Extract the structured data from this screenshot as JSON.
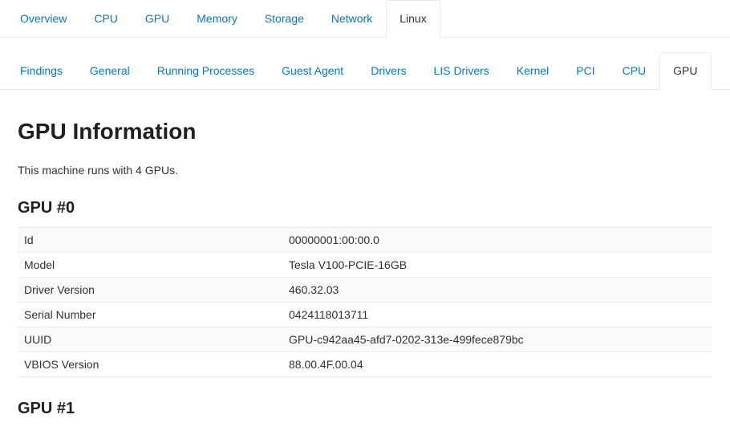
{
  "primaryTabs": [
    {
      "label": "Overview",
      "active": false,
      "name": "tab-overview"
    },
    {
      "label": "CPU",
      "active": false,
      "name": "tab-cpu"
    },
    {
      "label": "GPU",
      "active": false,
      "name": "tab-gpu"
    },
    {
      "label": "Memory",
      "active": false,
      "name": "tab-memory"
    },
    {
      "label": "Storage",
      "active": false,
      "name": "tab-storage"
    },
    {
      "label": "Network",
      "active": false,
      "name": "tab-network"
    },
    {
      "label": "Linux",
      "active": true,
      "name": "tab-linux"
    }
  ],
  "secondaryTabs": [
    {
      "label": "Findings",
      "active": false,
      "name": "subtab-findings"
    },
    {
      "label": "General",
      "active": false,
      "name": "subtab-general"
    },
    {
      "label": "Running Processes",
      "active": false,
      "name": "subtab-running-processes"
    },
    {
      "label": "Guest Agent",
      "active": false,
      "name": "subtab-guest-agent"
    },
    {
      "label": "Drivers",
      "active": false,
      "name": "subtab-drivers"
    },
    {
      "label": "LIS Drivers",
      "active": false,
      "name": "subtab-lis-drivers"
    },
    {
      "label": "Kernel",
      "active": false,
      "name": "subtab-kernel"
    },
    {
      "label": "PCI",
      "active": false,
      "name": "subtab-pci"
    },
    {
      "label": "CPU",
      "active": false,
      "name": "subtab-cpu"
    },
    {
      "label": "GPU",
      "active": true,
      "name": "subtab-gpu"
    }
  ],
  "page": {
    "title": "GPU Information",
    "summary": "This machine runs with 4 GPUs."
  },
  "gpuSections": [
    {
      "heading": "GPU #0",
      "rows": [
        {
          "key": "Id",
          "value": "00000001:00:00.0"
        },
        {
          "key": "Model",
          "value": "Tesla V100-PCIE-16GB"
        },
        {
          "key": "Driver Version",
          "value": "460.32.03"
        },
        {
          "key": "Serial Number",
          "value": "0424118013711"
        },
        {
          "key": "UUID",
          "value": "GPU-c942aa45-afd7-0202-313e-499fece879bc"
        },
        {
          "key": "VBIOS Version",
          "value": "88.00.4F.00.04"
        }
      ]
    },
    {
      "heading": "GPU #1",
      "rows": []
    }
  ]
}
